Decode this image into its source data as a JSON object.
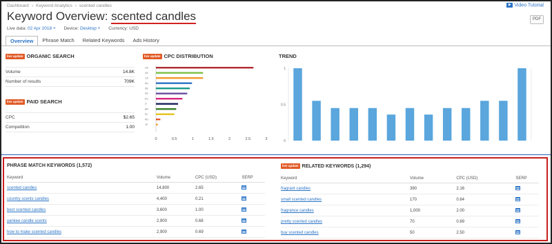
{
  "breadcrumb": [
    "Dashboard",
    "Keyword Analytics",
    "scented candles"
  ],
  "video_tutorial": "Video Tutorial",
  "title": {
    "prefix": "Keyword Overview: ",
    "keyword": "scented candles"
  },
  "meta": {
    "live_label": "Live data:",
    "live_value": "02 Apr 2018",
    "device_label": "Device:",
    "device_value": "Desktop",
    "currency": "Currency: USD"
  },
  "pdf_label": "PDF",
  "tabs": [
    "Overview",
    "Phrase Match",
    "Related Keywords",
    "Ads History"
  ],
  "badge": "live update",
  "organic": {
    "title": "ORGANIC SEARCH",
    "rows": [
      {
        "label": "Volume",
        "value": "14.8K"
      },
      {
        "label": "Number of results",
        "value": "709K"
      }
    ]
  },
  "paid": {
    "title": "PAID SEARCH",
    "rows": [
      {
        "label": "CPC",
        "value": "$2.65"
      },
      {
        "label": "Competition",
        "value": "1.00"
      }
    ]
  },
  "cpc_title": "CPC DISTRIBUTION",
  "trend_title": "TREND",
  "chart_data": [
    {
      "type": "bar",
      "orientation": "horizontal",
      "title": "CPC DISTRIBUTION",
      "categories": [
        "US",
        "UK",
        "CA",
        "AU",
        "DE",
        "FR",
        "ES",
        "IT",
        "BR",
        "IN",
        "RU",
        "JP"
      ],
      "values": [
        2.65,
        1.28,
        1.28,
        0.98,
        0.92,
        0.85,
        0.72,
        0.6,
        0.55,
        0.5,
        0.12,
        0.05
      ],
      "colors": [
        "#b02a30",
        "#7dbf44",
        "#f29b2b",
        "#2a73c5",
        "#1a9a8a",
        "#6a4ca0",
        "#d9247a",
        "#1b1f5a",
        "#3a7d2a",
        "#e7c21c",
        "#e05a2a",
        "#f29b2b"
      ],
      "xticks": [
        "0",
        "0.5",
        "1",
        "1.5",
        "2",
        "2.5",
        "3"
      ],
      "xlim": [
        0,
        3
      ]
    },
    {
      "type": "bar",
      "title": "TREND",
      "values": [
        1.0,
        0.55,
        0.45,
        0.45,
        0.45,
        0.36,
        0.45,
        0.36,
        0.45,
        0.45,
        0.55,
        0.55,
        1.0
      ],
      "yticks": [
        "1",
        "0.5",
        "0"
      ],
      "ylim": [
        0,
        1
      ],
      "color": "#5aa6dd"
    }
  ],
  "phrase": {
    "title": "PHRASE MATCH KEYWORDS (1,572)",
    "headers": [
      "Keyword",
      "Volume",
      "CPC (USD)",
      "SERP"
    ],
    "rows": [
      {
        "kw": "scented candles",
        "vol": "14,800",
        "cpc": "2.65"
      },
      {
        "kw": "country scents candles",
        "vol": "4,400",
        "cpc": "0.21"
      },
      {
        "kw": "best scented candles",
        "vol": "3,600",
        "cpc": "1.00"
      },
      {
        "kw": "yankee candle scents",
        "vol": "2,900",
        "cpc": "0.68"
      },
      {
        "kw": "how to make scented candles",
        "vol": "2,900",
        "cpc": "0.69"
      }
    ]
  },
  "related": {
    "title": "RELATED KEYWORDS (1,294)",
    "headers": [
      "Keyword",
      "Volume",
      "CPC (USD)",
      "SERP"
    ],
    "rows": [
      {
        "kw": "fragrant candles",
        "vol": "390",
        "cpc": "2.16"
      },
      {
        "kw": "small scented candles",
        "vol": "170",
        "cpc": "0.64"
      },
      {
        "kw": "fragrance candles",
        "vol": "1,000",
        "cpc": "2.00"
      },
      {
        "kw": "pretty scented candles",
        "vol": "70",
        "cpc": "0.69"
      },
      {
        "kw": "buy scented candles",
        "vol": "50",
        "cpc": "2.50"
      }
    ]
  }
}
